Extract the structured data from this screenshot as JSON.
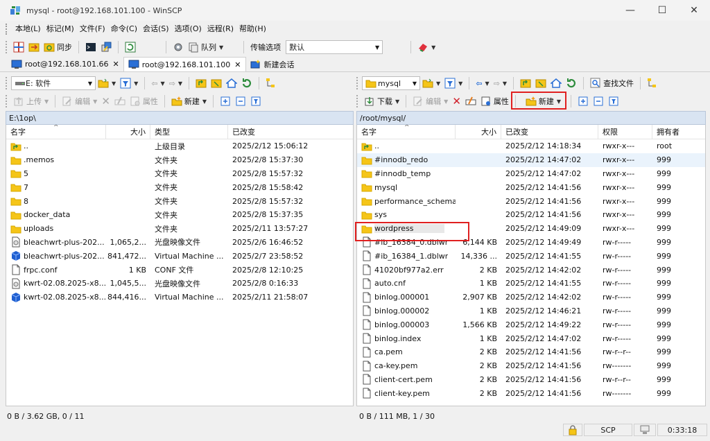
{
  "window": {
    "title": "mysql - root@192.168.101.100 - WinSCP",
    "minimize": "—",
    "maximize": "☐",
    "close": "✕"
  },
  "menu": [
    "本地(L)",
    "标记(M)",
    "文件(F)",
    "命令(C)",
    "会话(S)",
    "选项(O)",
    "远程(R)",
    "帮助(H)"
  ],
  "toolbar": {
    "sync": "同步",
    "queue": "队列",
    "transfer_label": "传输选项",
    "transfer_value": "默认"
  },
  "tabs": [
    {
      "label": "root@192.168.101.66",
      "close": "✕"
    },
    {
      "label": "root@192.168.101.100",
      "close": "✕"
    },
    {
      "label": "新建会话"
    }
  ],
  "left": {
    "drive": "E: 软件",
    "actions": {
      "upload": "上传",
      "edit": "编辑",
      "properties": "属性",
      "new": "新建"
    },
    "path": "E:\\1op\\",
    "columns": [
      "名字",
      "大小",
      "类型",
      "已改变"
    ],
    "files": [
      {
        "icon": "parent-dir",
        "name": "..",
        "size": "",
        "type": "上级目录",
        "changed": "2025/2/12  15:06:12"
      },
      {
        "icon": "folder",
        "name": ".memos",
        "size": "",
        "type": "文件夹",
        "changed": "2025/2/8  15:37:30"
      },
      {
        "icon": "folder",
        "name": "5",
        "size": "",
        "type": "文件夹",
        "changed": "2025/2/8  15:57:32"
      },
      {
        "icon": "folder",
        "name": "7",
        "size": "",
        "type": "文件夹",
        "changed": "2025/2/8  15:58:42"
      },
      {
        "icon": "folder",
        "name": "8",
        "size": "",
        "type": "文件夹",
        "changed": "2025/2/8  15:57:32"
      },
      {
        "icon": "folder",
        "name": "docker_data",
        "size": "",
        "type": "文件夹",
        "changed": "2025/2/8  15:37:35"
      },
      {
        "icon": "folder",
        "name": "uploads",
        "size": "",
        "type": "文件夹",
        "changed": "2025/2/11  13:57:27"
      },
      {
        "icon": "disc-image",
        "name": "bleachwrt-plus-202...",
        "size": "1,065,2...",
        "type": "光盘映像文件",
        "changed": "2025/2/6  16:46:52"
      },
      {
        "icon": "vm-disk",
        "name": "bleachwrt-plus-202...",
        "size": "841,472...",
        "type": "Virtual Machine ...",
        "changed": "2025/2/7  23:58:52"
      },
      {
        "icon": "file",
        "name": "frpc.conf",
        "size": "1 KB",
        "type": "CONF 文件",
        "changed": "2025/2/8  12:10:25"
      },
      {
        "icon": "disc-image",
        "name": "kwrt-02.08.2025-x8...",
        "size": "1,045,5...",
        "type": "光盘映像文件",
        "changed": "2025/2/8  0:16:33"
      },
      {
        "icon": "vm-disk",
        "name": "kwrt-02.08.2025-x8...",
        "size": "844,416...",
        "type": "Virtual Machine ...",
        "changed": "2025/2/11  21:58:07"
      }
    ],
    "status": "0 B / 3.62 GB,   0 / 11"
  },
  "right": {
    "drive": "mysql",
    "actions": {
      "download": "下载",
      "edit": "编辑",
      "properties": "属性",
      "new": "新建",
      "find": "查找文件"
    },
    "path": "/root/mysql/",
    "columns": [
      "名字",
      "大小",
      "已改变",
      "权限",
      "拥有者"
    ],
    "files": [
      {
        "icon": "parent-dir",
        "name": "..",
        "size": "",
        "changed": "2025/2/12 14:18:34",
        "rights": "rwxr-x---",
        "owner": "root"
      },
      {
        "icon": "folder",
        "name": "#innodb_redo",
        "size": "",
        "changed": "2025/2/12 14:47:02",
        "rights": "rwxr-x---",
        "owner": "999"
      },
      {
        "icon": "folder",
        "name": "#innodb_temp",
        "size": "",
        "changed": "2025/2/12 14:47:02",
        "rights": "rwxr-x---",
        "owner": "999"
      },
      {
        "icon": "folder",
        "name": "mysql",
        "size": "",
        "changed": "2025/2/12 14:41:56",
        "rights": "rwxr-x---",
        "owner": "999"
      },
      {
        "icon": "folder",
        "name": "performance_schema",
        "size": "",
        "changed": "2025/2/12 14:41:56",
        "rights": "rwxr-x---",
        "owner": "999"
      },
      {
        "icon": "folder",
        "name": "sys",
        "size": "",
        "changed": "2025/2/12 14:41:56",
        "rights": "rwxr-x---",
        "owner": "999"
      },
      {
        "icon": "folder",
        "name": "wordpress",
        "size": "",
        "changed": "2025/2/12 14:49:09",
        "rights": "rwxr-x---",
        "owner": "999"
      },
      {
        "icon": "file",
        "name": "#ib_16384_0.dblwr",
        "size": "6,144 KB",
        "changed": "2025/2/12 14:49:49",
        "rights": "rw-r-----",
        "owner": "999"
      },
      {
        "icon": "file",
        "name": "#ib_16384_1.dblwr",
        "size": "14,336 ...",
        "changed": "2025/2/12 14:41:55",
        "rights": "rw-r-----",
        "owner": "999"
      },
      {
        "icon": "file",
        "name": "41020bf977a2.err",
        "size": "2 KB",
        "changed": "2025/2/12 14:42:02",
        "rights": "rw-r-----",
        "owner": "999"
      },
      {
        "icon": "file",
        "name": "auto.cnf",
        "size": "1 KB",
        "changed": "2025/2/12 14:41:55",
        "rights": "rw-r-----",
        "owner": "999"
      },
      {
        "icon": "file",
        "name": "binlog.000001",
        "size": "2,907 KB",
        "changed": "2025/2/12 14:42:02",
        "rights": "rw-r-----",
        "owner": "999"
      },
      {
        "icon": "file",
        "name": "binlog.000002",
        "size": "1 KB",
        "changed": "2025/2/12 14:46:21",
        "rights": "rw-r-----",
        "owner": "999"
      },
      {
        "icon": "file",
        "name": "binlog.000003",
        "size": "1,566 KB",
        "changed": "2025/2/12 14:49:22",
        "rights": "rw-r-----",
        "owner": "999"
      },
      {
        "icon": "file",
        "name": "binlog.index",
        "size": "1 KB",
        "changed": "2025/2/12 14:47:02",
        "rights": "rw-r-----",
        "owner": "999"
      },
      {
        "icon": "file",
        "name": "ca.pem",
        "size": "2 KB",
        "changed": "2025/2/12 14:41:56",
        "rights": "rw-r--r--",
        "owner": "999"
      },
      {
        "icon": "file",
        "name": "ca-key.pem",
        "size": "2 KB",
        "changed": "2025/2/12 14:41:56",
        "rights": "rw-------",
        "owner": "999"
      },
      {
        "icon": "file",
        "name": "client-cert.pem",
        "size": "2 KB",
        "changed": "2025/2/12 14:41:56",
        "rights": "rw-r--r--",
        "owner": "999"
      },
      {
        "icon": "file",
        "name": "client-key.pem",
        "size": "2 KB",
        "changed": "2025/2/12 14:41:56",
        "rights": "rw-------",
        "owner": "999"
      }
    ],
    "status": "0 B / 111 MB,   1 / 30"
  },
  "bottom": {
    "protocol": "SCP",
    "elapsed": "0:33:18"
  },
  "colors": {
    "path_bg": "#d9e4f2",
    "folder": "#f5c518",
    "highlight": "#e02020"
  }
}
